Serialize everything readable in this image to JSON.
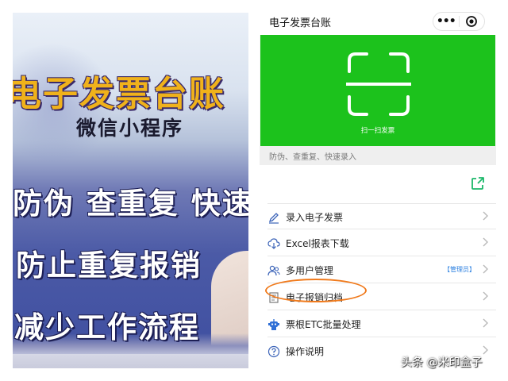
{
  "promo": {
    "title": "电子发票台账",
    "subtitle": "微信小程序",
    "line1": "防伪 查重复 快速",
    "line2": "防止重复报销",
    "line3": "减少工作流程"
  },
  "app": {
    "title": "电子发票台账",
    "more_icon": "more-dots-icon",
    "close_icon": "target-close-icon"
  },
  "scan": {
    "label": "扫一扫发票",
    "icon": "scan-frame-icon",
    "bg_color": "#1cc21c"
  },
  "hint": "防伪、查重复、快速录入",
  "menu": {
    "share_icon": "share-export-icon",
    "items": [
      {
        "label": "录入电子发票",
        "icon": "pen-icon"
      },
      {
        "label": "Excel报表下载",
        "icon": "cloud-download-icon"
      },
      {
        "label": "多用户管理",
        "icon": "users-icon",
        "badge": "【管理员】"
      },
      {
        "label": "电子报销归档",
        "icon": "archive-icon",
        "highlighted": true
      },
      {
        "label": "票根ETC批量处理",
        "icon": "robot-icon"
      },
      {
        "label": "操作说明",
        "icon": "help-circle-icon"
      }
    ]
  },
  "watermark": "头条 @米印盒子",
  "colors": {
    "highlight": "#f07a1c",
    "promo_title": "#f0b21b",
    "badge": "#2a7fe0"
  }
}
